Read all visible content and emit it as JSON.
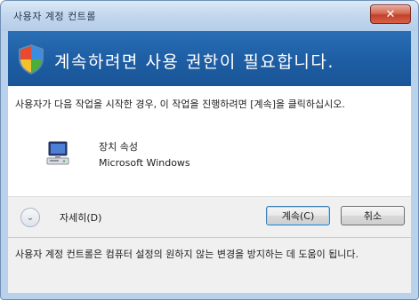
{
  "window": {
    "title": "사용자 계정 컨트롤",
    "close_label": "✕"
  },
  "banner": {
    "icon": "uac-shield-icon",
    "heading": "계속하려면 사용 권한이 필요합니다."
  },
  "content": {
    "description": "사용자가 다음 작업을 시작한 경우, 이 작업을 진행하려면 [계속]을 클릭하십시오.",
    "program": {
      "icon": "computer-icon",
      "name": "장치 속성",
      "publisher": "Microsoft Windows"
    }
  },
  "buttons": {
    "details_label": "자세히(D)",
    "details_icon": "chevron-down-icon",
    "continue_label": "계속(C)",
    "cancel_label": "취소"
  },
  "footer": {
    "text": "사용자 계정 컨트롤은 컴퓨터 설정의 원하지 않는 변경을 방지하는 데 도움이 됩니다."
  }
}
